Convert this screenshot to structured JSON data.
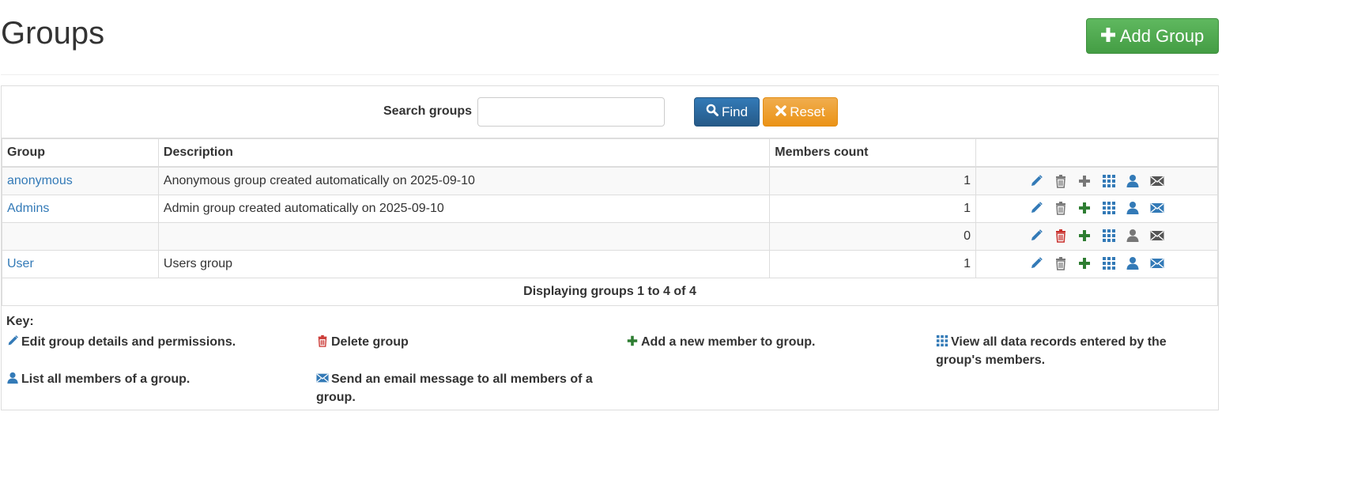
{
  "page": {
    "title": "Groups",
    "add_group_label": "Add Group"
  },
  "search": {
    "label": "Search groups",
    "value": "",
    "placeholder": "",
    "find_label": "Find",
    "reset_label": "Reset"
  },
  "table": {
    "columns": [
      "Group",
      "Description",
      "Members count",
      ""
    ],
    "rows": [
      {
        "group": "anonymous",
        "description": "Anonymous group created automatically on 2025-09-10",
        "members": "1"
      },
      {
        "group": "Admins",
        "description": "Admin group created automatically on 2025-09-10",
        "members": "1"
      },
      {
        "group": "",
        "description": "",
        "members": "0"
      },
      {
        "group": "User",
        "description": "Users group",
        "members": "1"
      }
    ],
    "footer": "Displaying groups 1 to 4 of 4"
  },
  "key": {
    "title": "Key:",
    "edit": "Edit group details and permissions.",
    "delete": "Delete group",
    "add_member": "Add a new member to group.",
    "view_records": "View all data records entered by the group's members.",
    "list_members": "List all members of a group.",
    "send_email": "Send an email message to all members of a group."
  },
  "colors": {
    "primary": "#337ab7",
    "success": "#5cb85c",
    "warning": "#f0ad4e",
    "danger": "#c9302c",
    "add_green": "#2e7d32",
    "muted_gray": "#777777"
  },
  "icons": [
    "plus-icon",
    "search-icon",
    "x-icon",
    "pencil-icon",
    "trash-icon",
    "grid-icon",
    "user-icon",
    "envelope-icon"
  ]
}
